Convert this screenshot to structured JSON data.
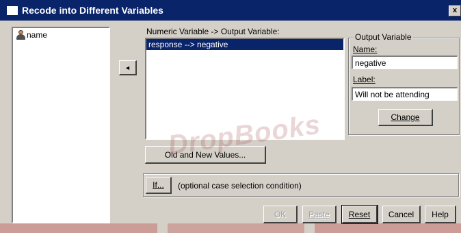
{
  "window": {
    "title": "Recode into Different Variables",
    "close_glyph": "x"
  },
  "source_list": {
    "items": [
      {
        "label": "name",
        "icon": "person-variable-icon"
      }
    ]
  },
  "move_arrow_glyph": "◄",
  "mapping": {
    "header": "Numeric Variable -> Output Variable:",
    "rows": [
      "response --> negative"
    ]
  },
  "output": {
    "legend": "Output Variable",
    "name_label": "Name:",
    "name_value": "negative",
    "label_label": "Label:",
    "label_value": "Will not be attending",
    "change_button": "Change"
  },
  "old_new_button": "Old and New Values...",
  "if_button": "If...",
  "if_hint": "(optional case selection condition)",
  "buttons": {
    "ok": "OK",
    "paste": "Paste",
    "reset": "Reset",
    "cancel": "Cancel",
    "help": "Help"
  },
  "watermark": "DropBooks",
  "colors": {
    "titlebar": "#0a246a",
    "dialog": "#d4d0c8",
    "selection": "#0a246a",
    "watermark": "#a04646"
  }
}
